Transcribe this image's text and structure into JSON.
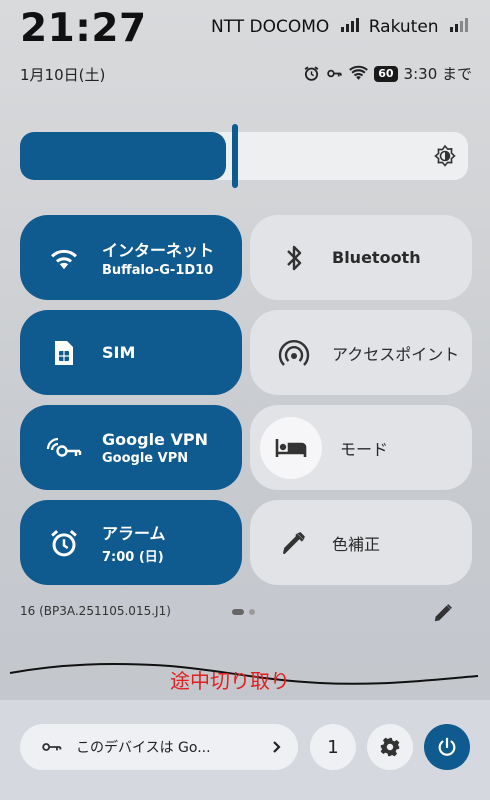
{
  "status_bar": {
    "time": "21:27",
    "carrier1": "NTT DOCOMO",
    "carrier2": "Rakuten",
    "date": "1月10日(土)",
    "battery": "60",
    "alarm_until": "3:30 まで"
  },
  "brightness": {
    "level": 0.46,
    "icon": "brightness-auto-icon"
  },
  "tiles": [
    {
      "title": "インターネット",
      "subtitle": "Buffalo-G-1D10",
      "icon": "wifi-icon",
      "state": "on"
    },
    {
      "title": "Bluetooth",
      "icon": "bluetooth-icon",
      "state": "off"
    },
    {
      "title": "SIM",
      "icon": "sim-card-icon",
      "state": "on"
    },
    {
      "title": "アクセスポイント",
      "icon": "hotspot-icon",
      "state": "off"
    },
    {
      "title": "Google VPN",
      "subtitle": "Google VPN",
      "icon": "vpn-key-icon",
      "state": "on"
    },
    {
      "title": "モード",
      "icon": "bed-icon",
      "state": "off"
    },
    {
      "title": "アラーム",
      "subtitle": "7:00 (日)",
      "icon": "alarm-icon",
      "state": "on"
    },
    {
      "title": "色補正",
      "icon": "color-picker-icon",
      "state": "off"
    }
  ],
  "build": "16 (BP3A.251105.015.J1)",
  "crop_note": "途中切り取り",
  "bottom": {
    "device_label": "このデバイスは Go...",
    "count": "1"
  },
  "colors": {
    "accent": "#0f5a8f",
    "tile_off": "#e2e3e6",
    "annotation": "#e02020"
  }
}
